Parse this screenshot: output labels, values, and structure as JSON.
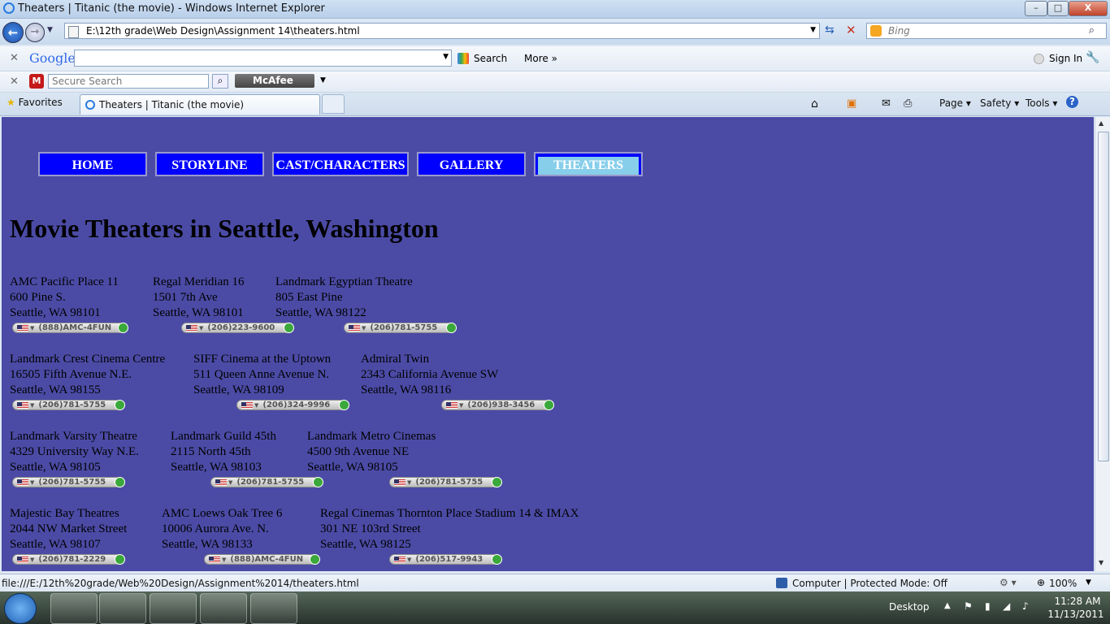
{
  "window": {
    "title": "Theaters | Titanic (the movie) - Windows Internet Explorer",
    "min": "–",
    "max": "□",
    "close": "X"
  },
  "address_bar": {
    "url": "E:\\12th grade\\Web Design\\Assignment 14\\theaters.html",
    "search_placeholder": "Bing"
  },
  "google_toolbar": {
    "logo": "Google",
    "search_label": "Search",
    "more_label": "More »",
    "sign_in": "Sign In"
  },
  "mcafee_toolbar": {
    "search_placeholder": "Secure Search",
    "brand": "McAfee"
  },
  "tabs": {
    "favorites": "Favorites",
    "active": "Theaters | Titanic (the movie)",
    "commands": {
      "page": "Page",
      "safety": "Safety",
      "tools": "Tools"
    }
  },
  "site": {
    "nav": [
      "HOME",
      "STORYLINE",
      "CAST/CHARACTERS",
      "GALLERY",
      "THEATERS"
    ],
    "active_nav": "THEATERS",
    "heading": "Movie Theaters in Seattle, Washington",
    "theaters": [
      {
        "name": "AMC Pacific Place 11",
        "street": "600 Pine S.",
        "city": "Seattle, WA 98101",
        "phone": "(888)AMC-4FUN"
      },
      {
        "name": "Regal Meridian 16",
        "street": "1501 7th Ave",
        "city": "Seattle, WA 98101",
        "phone": "(206)223-9600"
      },
      {
        "name": "Landmark Egyptian Theatre",
        "street": "805 East Pine",
        "city": "Seattle, WA 98122",
        "phone": "(206)781-5755"
      },
      {
        "name": "Landmark Crest Cinema Centre",
        "street": "16505 Fifth Avenue N.E.",
        "city": "Seattle, WA 98155",
        "phone": "(206)781-5755"
      },
      {
        "name": "SIFF Cinema at the Uptown",
        "street": "511 Queen Anne Avenue N.",
        "city": "Seattle, WA 98109",
        "phone": "(206)324-9996"
      },
      {
        "name": "Admiral Twin",
        "street": "2343 California Avenue SW",
        "city": "Seattle, WA 98116",
        "phone": "(206)938-3456"
      },
      {
        "name": "Landmark Varsity Theatre",
        "street": "4329 University Way N.E.",
        "city": "Seattle, WA 98105",
        "phone": "(206)781-5755"
      },
      {
        "name": "Landmark Guild 45th",
        "street": "2115 North 45th",
        "city": "Seattle, WA 98103",
        "phone": "(206)781-5755"
      },
      {
        "name": "Landmark Metro Cinemas",
        "street": "4500 9th Avenue NE",
        "city": "Seattle, WA 98105",
        "phone": "(206)781-5755"
      },
      {
        "name": "Majestic Bay Theatres",
        "street": "2044 NW Market Street",
        "city": "Seattle, WA 98107",
        "phone": "(206)781-2229"
      },
      {
        "name": "AMC Loews Oak Tree 6",
        "street": "10006 Aurora Ave. N.",
        "city": "Seattle, WA 98133",
        "phone": "(888)AMC-4FUN"
      },
      {
        "name": "Regal Cinemas Thornton Place Stadium 14 & IMAX",
        "street": "301 NE 103rd Street",
        "city": "Seattle, WA 98125",
        "phone": "(206)517-9943"
      }
    ]
  },
  "statusbar": {
    "url": "file:///E:/12th%20grade/Web%20Design/Assignment%2014/theaters.html",
    "zone": "Computer | Protected Mode: Off",
    "zoom": "100%"
  },
  "taskbar": {
    "desktop": "Desktop",
    "time": "11:28 AM",
    "date": "11/13/2011"
  },
  "colors": {
    "page_bg": "#4b4ba6",
    "nav_bg": "#0000ff",
    "nav_active": "#87ceeb"
  }
}
